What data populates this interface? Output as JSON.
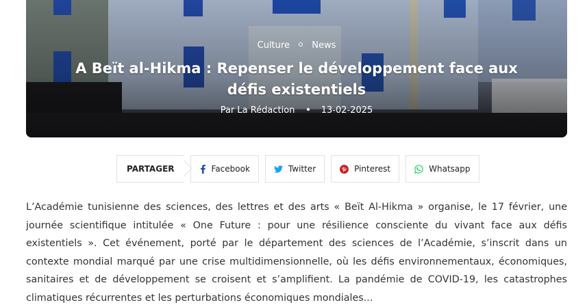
{
  "hero": {
    "categories": [
      "Culture",
      "News"
    ],
    "title": "A Beït al-Hikma : Repenser le développement face aux défis existentiels",
    "author": "Par La Rédaction",
    "date": "13-02-2025"
  },
  "share": {
    "label": "PARTAGER",
    "buttons": [
      {
        "name": "facebook",
        "label": "Facebook",
        "icon": "facebook-icon",
        "color": "#1f4e9c"
      },
      {
        "name": "twitter",
        "label": "Twitter",
        "icon": "twitter-icon",
        "color": "#1da1f2"
      },
      {
        "name": "pinterest",
        "label": "Pinterest",
        "icon": "pinterest-icon",
        "color": "#c8232c"
      },
      {
        "name": "whatsapp",
        "label": "Whatsapp",
        "icon": "whatsapp-icon",
        "color": "#25d366"
      }
    ]
  },
  "article": {
    "body": "L’Académie tunisienne des sciences, des lettres et des arts « Beït Al-Hikma » organise, le 17 février, une journée scientifique intitulée « One Future : pour une résilience consciente du vivant face aux défis existentiels ». Cet événement, porté par le département des sciences de l’Académie, s’inscrit dans un contexte mondial marqué par une crise multidimensionnelle, où les défis environnementaux, économiques, sanitaires et de développement se croisent et s’amplifient. La pandémie de COVID-19, les catastrophes climatiques récurrentes et les perturbations économiques mondiales..."
  }
}
